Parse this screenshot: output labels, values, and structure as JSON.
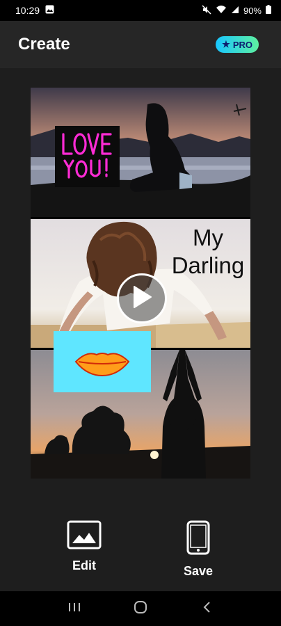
{
  "status": {
    "time": "10:29",
    "battery": "90%"
  },
  "header": {
    "title": "Create",
    "pro_label": "PRO"
  },
  "collage": {
    "text_line1": "My",
    "text_line2": "Darling"
  },
  "actions": {
    "edit_label": "Edit",
    "save_label": "Save"
  },
  "icons": {
    "gallery": "gallery-icon",
    "mute": "mute-icon",
    "wifi": "wifi-icon",
    "signal": "signal-icon",
    "battery": "battery-icon",
    "star": "star-icon",
    "play": "play-icon",
    "image": "image-icon",
    "phone": "phone-icon",
    "recents": "recents-icon",
    "home": "home-icon",
    "back": "back-icon"
  },
  "colors": {
    "accent_from": "#18c6ff",
    "accent_to": "#5ef0a0",
    "lips_bg": "#5fe6ff",
    "love_text": "#ff2bd6"
  }
}
